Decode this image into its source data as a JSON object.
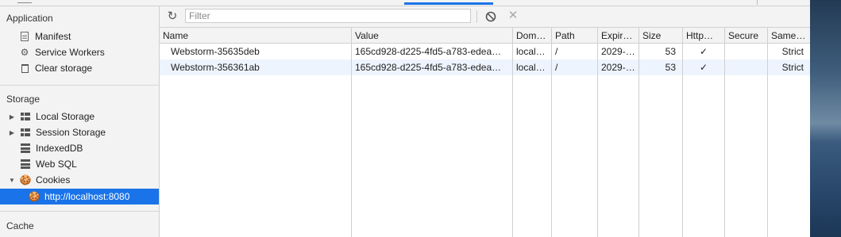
{
  "sidebar": {
    "application_title": "Application",
    "application_items": [
      {
        "label": "Manifest",
        "icon": "manifest-icon"
      },
      {
        "label": "Service Workers",
        "icon": "gear-icon"
      },
      {
        "label": "Clear storage",
        "icon": "trash-icon"
      }
    ],
    "storage_title": "Storage",
    "storage_items": [
      {
        "label": "Local Storage",
        "icon": "grid-icon",
        "expandable": true
      },
      {
        "label": "Session Storage",
        "icon": "grid-icon",
        "expandable": true
      },
      {
        "label": "IndexedDB",
        "icon": "database-icon"
      },
      {
        "label": "Web SQL",
        "icon": "database-icon"
      },
      {
        "label": "Cookies",
        "icon": "cookie-icon",
        "expanded": true
      }
    ],
    "cookie_origin": "http://localhost:8080",
    "cache_title": "Cache"
  },
  "toolbar": {
    "filter_placeholder": "Filter",
    "filter_value": ""
  },
  "table": {
    "columns": [
      "Name",
      "Value",
      "Dom…",
      "Path",
      "Expir…",
      "Size",
      "Http…",
      "Secure",
      "Same…"
    ],
    "rows": [
      [
        "Webstorm-35635deb",
        "165cd928-d225-4fd5-a783-edea…",
        "local…",
        "/",
        "2029-…",
        "53",
        "✓",
        "",
        "Strict"
      ],
      [
        "Webstorm-356361ab",
        "165cd928-d225-4fd5-a783-edea…",
        "local…",
        "/",
        "2029-…",
        "53",
        "✓",
        "",
        "Strict"
      ]
    ]
  },
  "colors": {
    "accent": "#1a73e8",
    "sidebar_bg": "#f3f3f3",
    "alt_row": "#eef4fd"
  }
}
